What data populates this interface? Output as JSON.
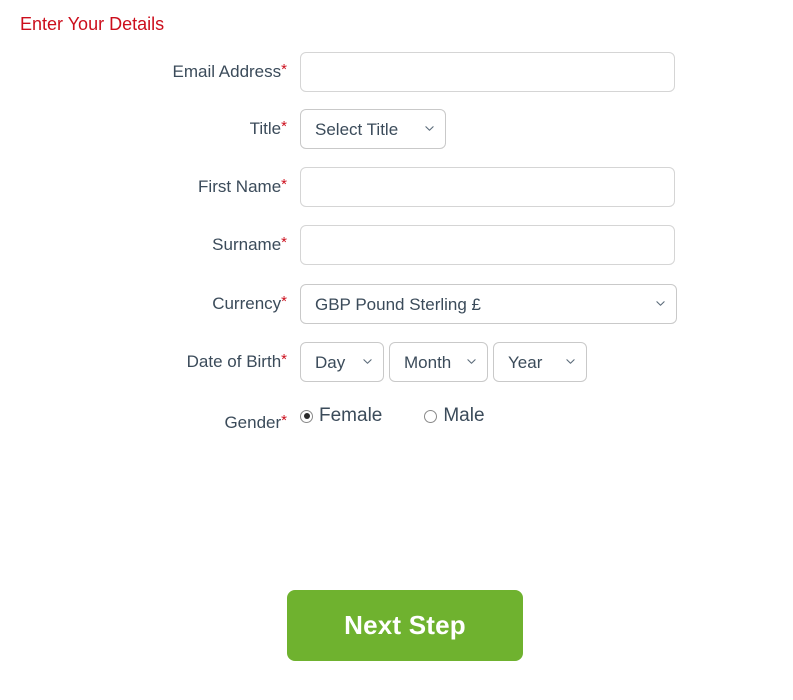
{
  "heading": "Enter Your Details",
  "colors": {
    "heading_red": "#cc0e1c",
    "required_red": "#cc0e1c",
    "label_text": "#3b4b5a",
    "button_green": "#6fb22f",
    "input_border": "#d5d5d5"
  },
  "fields": {
    "email": {
      "label": "Email Address",
      "required_mark": "*",
      "value": "",
      "placeholder": ""
    },
    "title": {
      "label": "Title",
      "required_mark": "*",
      "selected": "Select Title",
      "options": [
        "Select Title"
      ]
    },
    "first_name": {
      "label": "First Name",
      "required_mark": "*",
      "value": "",
      "placeholder": ""
    },
    "surname": {
      "label": "Surname",
      "required_mark": "*",
      "value": "",
      "placeholder": ""
    },
    "currency": {
      "label": "Currency",
      "required_mark": "*",
      "selected": "GBP Pound Sterling £",
      "options": [
        "GBP Pound Sterling £"
      ]
    },
    "date_of_birth": {
      "label": "Date of Birth",
      "required_mark": "*",
      "day": {
        "selected": "Day",
        "options": [
          "Day"
        ]
      },
      "month": {
        "selected": "Month",
        "options": [
          "Month"
        ]
      },
      "year": {
        "selected": "Year",
        "options": [
          "Year"
        ]
      }
    },
    "gender": {
      "label": "Gender",
      "required_mark": "*",
      "selected": "Female",
      "options": [
        {
          "label": "Female",
          "checked": true
        },
        {
          "label": "Male",
          "checked": false
        }
      ]
    }
  },
  "submit": {
    "label": "Next Step"
  },
  "icons": {
    "chevron": "chevron-down-icon"
  }
}
